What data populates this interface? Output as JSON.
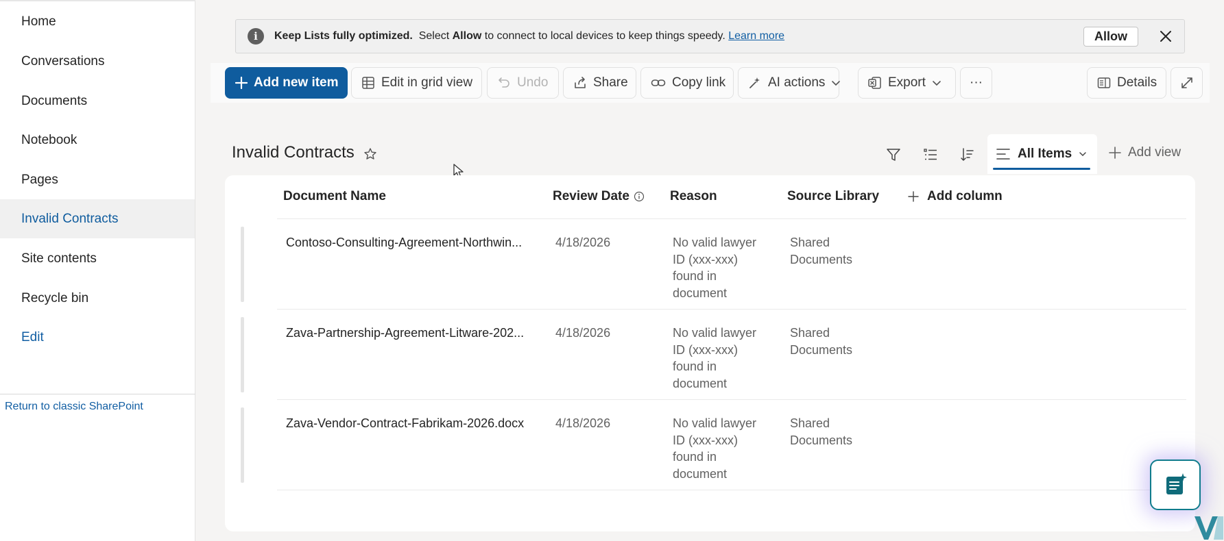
{
  "sidebar": {
    "items": [
      {
        "label": "Home"
      },
      {
        "label": "Conversations"
      },
      {
        "label": "Documents"
      },
      {
        "label": "Notebook"
      },
      {
        "label": "Pages"
      },
      {
        "label": "Invalid Contracts",
        "active": true
      },
      {
        "label": "Site contents"
      },
      {
        "label": "Recycle bin"
      },
      {
        "label": "Edit"
      }
    ],
    "classic_link": "Return to classic SharePoint"
  },
  "banner": {
    "icon": "info-icon",
    "bold_text": "Keep Lists fully optimized.",
    "text_before": "Select",
    "text_allow": "Allow",
    "text_after": "to connect to local devices to keep things speedy.",
    "learn_more": "Learn more",
    "allow_button": "Allow"
  },
  "toolbar": {
    "add_new_item": "Add new item",
    "edit_grid": "Edit in grid view",
    "undo": "Undo",
    "share": "Share",
    "copy_link": "Copy link",
    "ai_actions": "AI actions",
    "export": "Export",
    "more": "···",
    "details": "Details"
  },
  "list": {
    "title": "Invalid Contracts",
    "view_name": "All Items",
    "add_view": "Add view",
    "columns": {
      "document_name": "Document Name",
      "review_date": "Review Date",
      "reason": "Reason",
      "source_library": "Source Library",
      "add_column": "Add column"
    },
    "rows": [
      {
        "document_name": "Contoso-Consulting-Agreement-Northwin...",
        "review_date": "4/18/2026",
        "reason": [
          "No valid lawyer",
          "ID (xxx-xxx)",
          "found in",
          "document"
        ],
        "source_library": [
          "Shared",
          "Documents"
        ]
      },
      {
        "document_name": "Zava-Partnership-Agreement-Litware-202...",
        "review_date": "4/18/2026",
        "reason": [
          "No valid lawyer",
          "ID (xxx-xxx)",
          "found in",
          "document"
        ],
        "source_library": [
          "Shared",
          "Documents"
        ]
      },
      {
        "document_name": "Zava-Vendor-Contract-Fabrikam-2026.docx",
        "review_date": "4/18/2026",
        "reason": [
          "No valid lawyer",
          "ID (xxx-xxx)",
          "found in",
          "document"
        ],
        "source_library": [
          "Shared",
          "Documents"
        ]
      }
    ]
  },
  "colors": {
    "accent": "#0f5c9e",
    "link": "#115ea3",
    "sidebar_active_bg": "#f0f0f0",
    "page_bg": "#f5f4f3"
  }
}
